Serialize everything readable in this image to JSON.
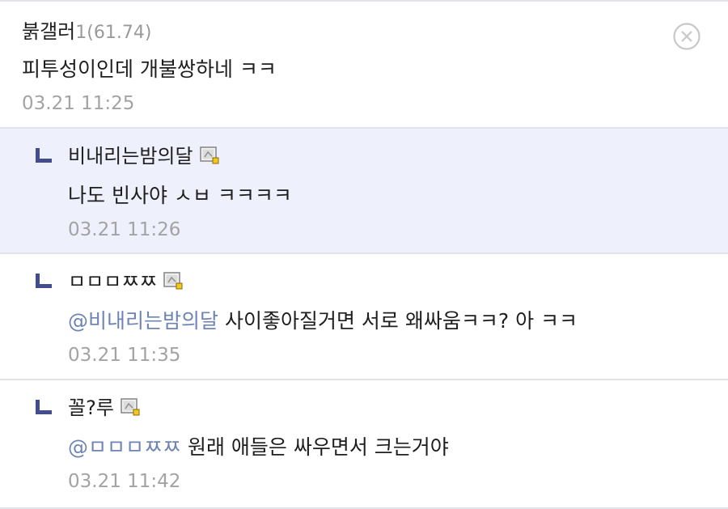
{
  "main_comment": {
    "nickname": "붉갤러",
    "gallog_num": "1",
    "ip": "(61.74)",
    "text": "피투성이인데 개불쌍하네 ㅋㅋ",
    "date": "03.21 11:25",
    "delete_icon": "close-circle-icon"
  },
  "replies": [
    {
      "nickname": "비내리는밤의달",
      "icon": "fixed-gallog-icon",
      "mention": "",
      "text": "나도 빈사야 ㅅㅂ ㅋㅋㅋㅋ",
      "date": "03.21 11:26"
    },
    {
      "nickname": "ㅁㅁㅁㅉㅉ",
      "icon": "fixed-gallog-icon",
      "mention": "@비내리는밤의달",
      "text": " 사이좋아질거면 서로 왜싸움ㅋㅋ? 아 ㅋㅋ",
      "date": "03.21 11:35"
    },
    {
      "nickname": "꼴?루",
      "icon": "fixed-gallog-icon",
      "mention": "@ㅁㅁㅁㅉㅉ",
      "text": " 원래 애들은 싸우면서 크는거야",
      "date": "03.21 11:42"
    }
  ],
  "colors": {
    "reply_highlight_bg": "#eef1fb",
    "mention": "#6d84b5",
    "reply_mark": "#434d8c",
    "date": "#a3a3a3"
  }
}
